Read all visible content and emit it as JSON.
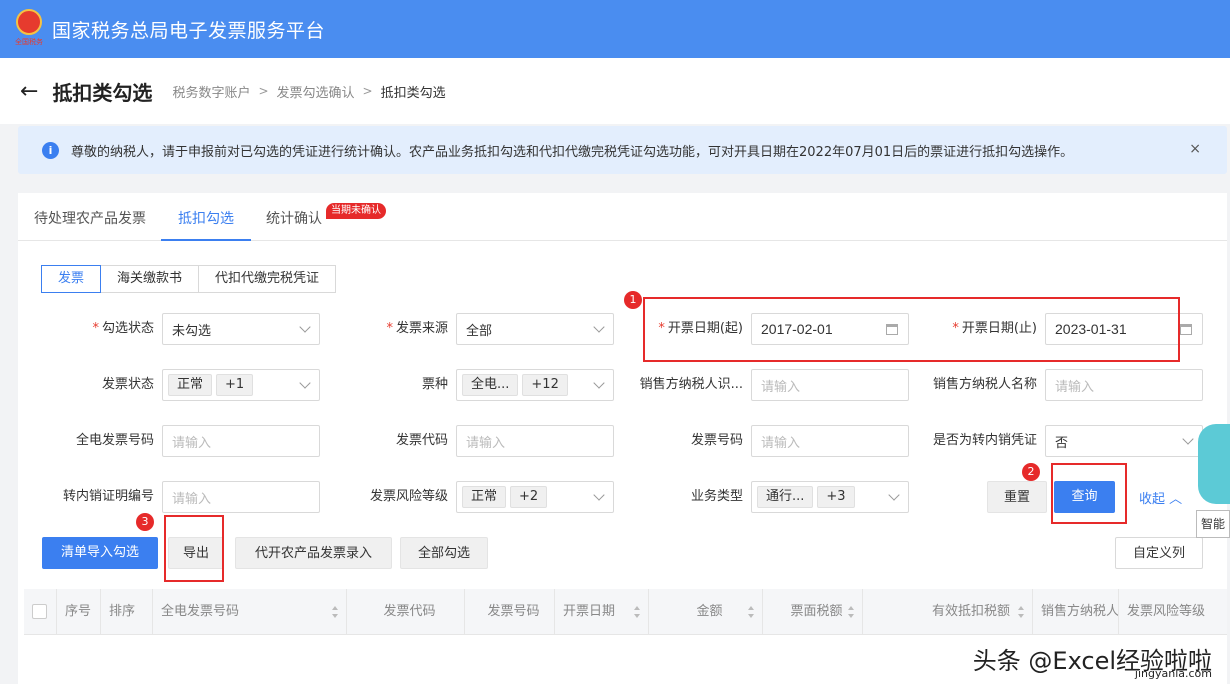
{
  "app": {
    "title": "国家税务总局电子发票服务平台",
    "emblem_text": "全国税务"
  },
  "header": {
    "title": "抵扣类勾选",
    "breadcrumb": [
      "税务数字账户",
      "发票勾选确认",
      "抵扣类勾选"
    ]
  },
  "notice": {
    "text": "尊敬的纳税人，请于申报前对已勾选的凭证进行统计确认。农产品业务抵扣勾选和代扣代缴完税凭证勾选功能，可对开具日期在2022年07月01日后的票证进行抵扣勾选操作。",
    "close": "×"
  },
  "tabs": [
    {
      "label": "待处理农产品发票"
    },
    {
      "label": "抵扣勾选"
    },
    {
      "label": "统计确认"
    }
  ],
  "tab_badge": "当期未确认",
  "subtabs": [
    {
      "label": "发票"
    },
    {
      "label": "海关缴款书"
    },
    {
      "label": "代扣代缴完税凭证"
    }
  ],
  "form": {
    "select_status": {
      "label": "勾选状态",
      "value": "未勾选"
    },
    "invoice_source": {
      "label": "发票来源",
      "value": "全部"
    },
    "date_start": {
      "label": "开票日期(起)",
      "value": "2017-02-01"
    },
    "date_end": {
      "label": "开票日期(止)",
      "value": "2023-01-31"
    },
    "invoice_status": {
      "label": "发票状态",
      "tag": "正常",
      "more": "+1"
    },
    "ticket_type": {
      "label": "票种",
      "tag": "全电...",
      "more": "+12"
    },
    "seller_tax_id": {
      "label": "销售方纳税人识...",
      "placeholder": "请输入"
    },
    "seller_name": {
      "label": "销售方纳税人名称",
      "placeholder": "请输入"
    },
    "full_invoice_no": {
      "label": "全电发票号码",
      "placeholder": "请输入"
    },
    "invoice_code": {
      "label": "发票代码",
      "placeholder": "请输入"
    },
    "invoice_no": {
      "label": "发票号码",
      "placeholder": "请输入"
    },
    "domestic_transfer": {
      "label": "是否为转内销凭证",
      "value": "否"
    },
    "transfer_cert_no": {
      "label": "转内销证明编号",
      "placeholder": "请输入"
    },
    "risk_level": {
      "label": "发票风险等级",
      "tag": "正常",
      "more": "+2"
    },
    "business_type": {
      "label": "业务类型",
      "tag": "通行...",
      "more": "+3"
    }
  },
  "buttons": {
    "reset": "重置",
    "query": "查询",
    "collapse": "收起",
    "import_select": "清单导入勾选",
    "export": "导出",
    "agri_entry": "代开农产品发票录入",
    "select_all": "全部勾选",
    "custom_columns": "自定义列"
  },
  "annotations": [
    "1",
    "2",
    "3"
  ],
  "table": {
    "columns": [
      "序号",
      "排序",
      "全电发票号码",
      "发票代码",
      "发票号码",
      "开票日期",
      "金额",
      "票面税额",
      "有效抵扣税额",
      "销售方纳税人...",
      "发票风险等级"
    ]
  },
  "assistant": {
    "label": "智能"
  },
  "watermark": {
    "text": "头条 @Excel经验啦啦",
    "sub": "jingyanla.com"
  },
  "colors": {
    "primary": "#3b7ff0",
    "topbar": "#4a8df0",
    "highlight": "#e62a2a"
  }
}
